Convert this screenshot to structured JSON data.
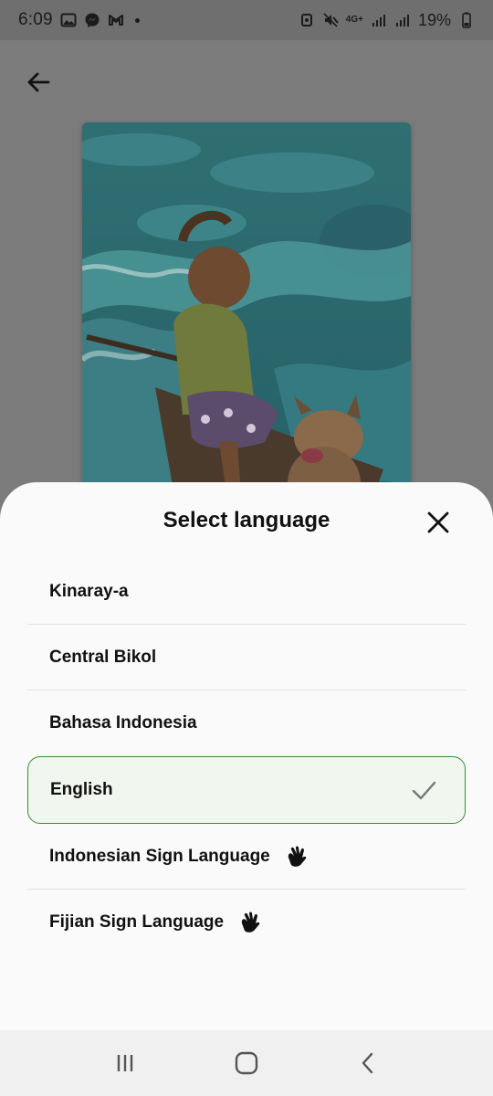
{
  "status_bar": {
    "time": "6:09",
    "network": "4G+",
    "battery": "19%"
  },
  "sheet": {
    "title": "Select language",
    "languages": [
      {
        "label": "Kinaray-a",
        "selected": false,
        "sign": false
      },
      {
        "label": "Central Bikol",
        "selected": false,
        "sign": false
      },
      {
        "label": "Bahasa Indonesia",
        "selected": false,
        "sign": false
      },
      {
        "label": "English",
        "selected": true,
        "sign": false
      },
      {
        "label": "Indonesian Sign Language",
        "selected": false,
        "sign": true
      },
      {
        "label": "Fijian Sign Language",
        "selected": false,
        "sign": true
      }
    ]
  },
  "icons": {
    "back": "arrow-left-icon",
    "close": "close-icon",
    "check": "check-icon",
    "sign": "hand-sign-icon",
    "nav_recents": "recents-icon",
    "nav_home": "home-icon",
    "nav_back": "chevron-left-icon"
  },
  "colors": {
    "selected_border": "#3e8a3a",
    "selected_bg": "#f1f6ef",
    "sheet_bg": "#fafafa",
    "scrim": "#7b7b7b"
  }
}
